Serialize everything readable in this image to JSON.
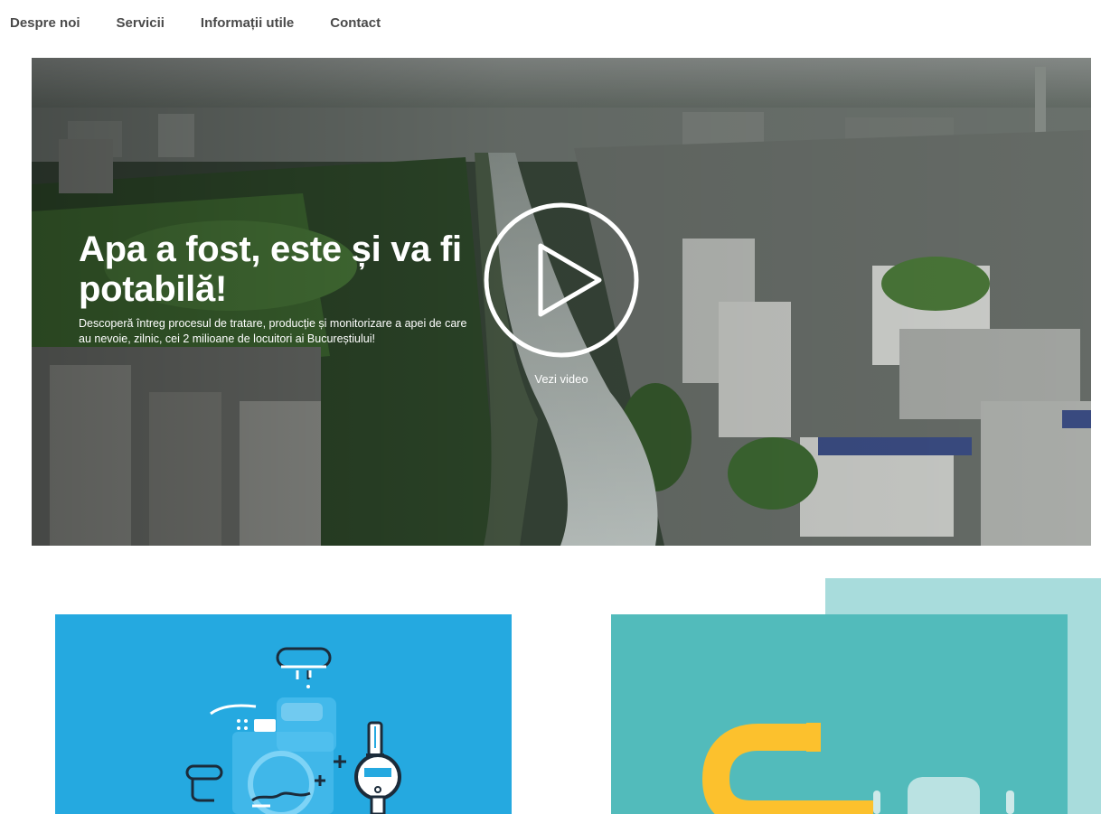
{
  "nav": {
    "items": [
      {
        "label": "Despre noi"
      },
      {
        "label": "Servicii"
      },
      {
        "label": "Informații utile"
      },
      {
        "label": "Contact"
      }
    ]
  },
  "hero": {
    "title": "Apa a fost, este și va fi potabilă!",
    "subtitle": "Descoperă întreg procesul de tratare, producție și monitorizare a apei de care au nevoie, zilnic, cei 2 milioane de locuitori ai Bucureștiului!",
    "video_label": "Vezi video"
  },
  "colors": {
    "nav_text": "#4a4a4a",
    "card_blue": "#25a9e0",
    "card_teal": "#52bbbb",
    "card_teal_back": "#a8dcdc",
    "accent_yellow": "#fcc12d"
  }
}
